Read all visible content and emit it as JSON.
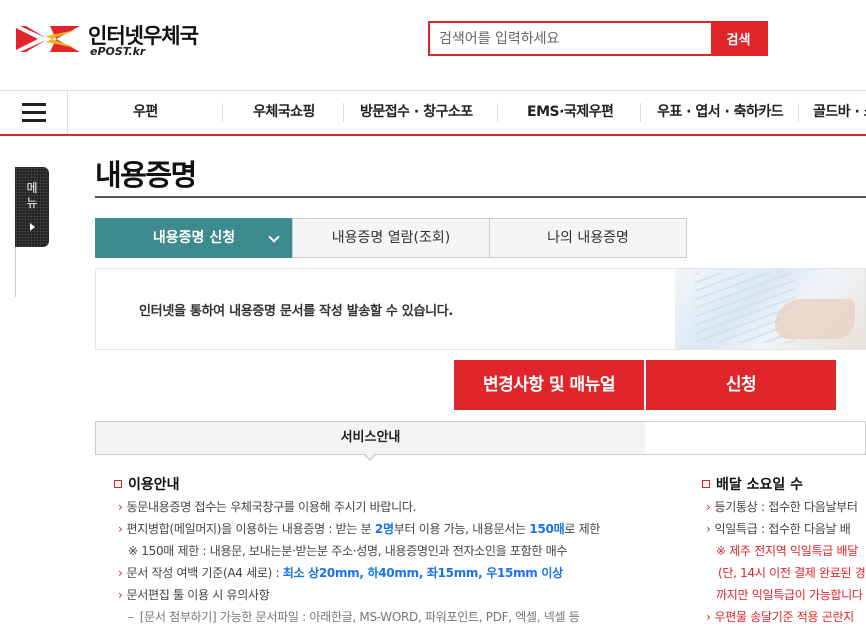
{
  "header": {
    "logo_title": "인터넷우체국",
    "logo_sub": "ePOST.kr",
    "search_placeholder": "검색어를 입력하세요",
    "search_button": "검색"
  },
  "gnb": {
    "items": [
      "우편",
      "우체국쇼핑",
      "방문접수 · 창구소포",
      "EMS·국제우편",
      "우표 · 엽서 · 축하카드",
      "골드바 · 소"
    ]
  },
  "side_tab": {
    "label_1": "메",
    "label_2": "뉴"
  },
  "page": {
    "title": "내용증명",
    "tabs": [
      "내용증명 신청",
      "내용증명 열람(조회)",
      "나의 내용증명"
    ],
    "intro_text": "인터넷을 통하여 내용증명 문서를 작성 발송할 수 있습니다.",
    "btn_manual": "변경사항 및 매뉴얼",
    "btn_apply": "신청",
    "service_tab": "서비스안내"
  },
  "usage": {
    "title": "이용안내",
    "l1": "동문내용증명 접수는 우체국창구를 이용해 주시기 바랍니다.",
    "l2a": "편지병합(메일머지)을 이용하는 내용증명 : 받는 분 ",
    "l2b": "2명",
    "l2c": "부터 이용 가능, 내용문서는 ",
    "l2d": "150매",
    "l2e": "로 제한",
    "l3": "※ 150매 제한 : 내용문, 보내는분·받는분 주소·성명, 내용증명인과 전자소인을 포함한 매수",
    "l4a": "문서 작성 여백 기준(A4 세로) : ",
    "l4b": "최소 상20mm, 하40mm, 좌15mm, 우15mm 이상",
    "l5": "문서편집 툴 이용 시 유의사항",
    "l6": "[문서 첨부하기] 가능한 문서파일 : 아래한글, MS-WORD, 파워포인트, PDF, 엑셀, 넥셀 등"
  },
  "delivery": {
    "title": "배달 소요일 수",
    "l1": "등기통상 : 접수한 다음날부터",
    "l2": "익일특급 : 접수한 다음날 배",
    "l3": "※ 제주 전지역 익일특급 배달",
    "l4": "(단, 14시 이전 결제 완료된 경",
    "l5": "까지만 익일특급이 가능합니다",
    "l6": "우편물 송달기준 적용 곤란지"
  },
  "colors": {
    "brand_red": "#e0262a",
    "tab_teal": "#3d8b8f",
    "link_blue": "#1a73e8"
  }
}
